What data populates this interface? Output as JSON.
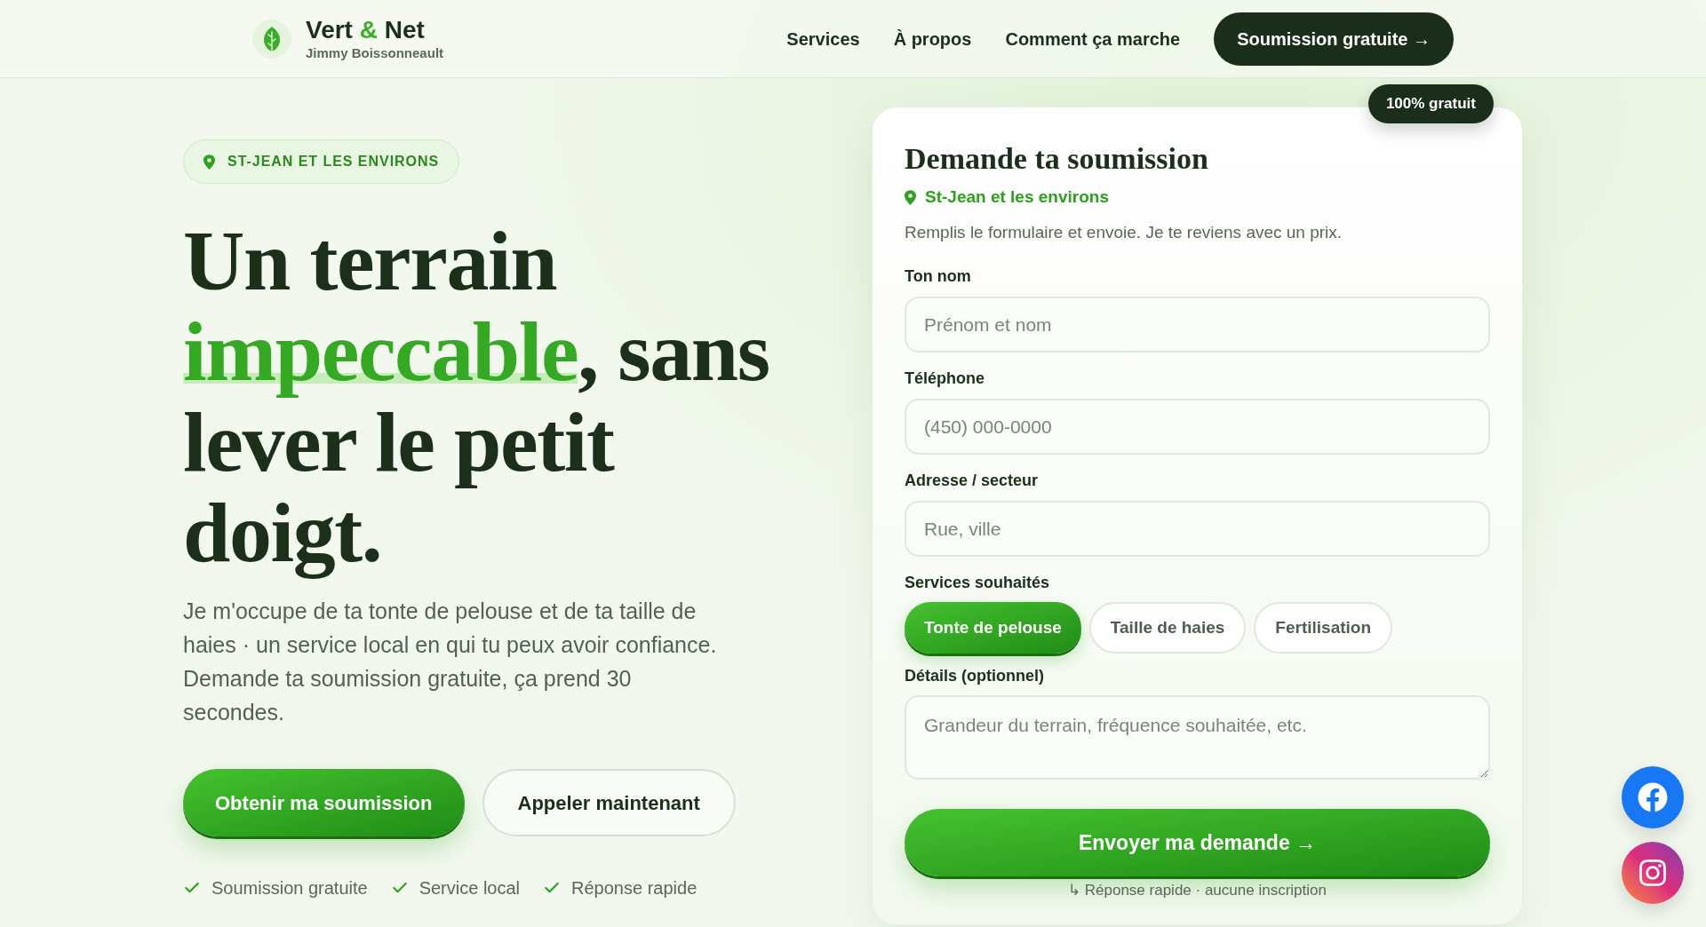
{
  "header": {
    "brand": {
      "name": [
        {
          "text": "Vert",
          "accent": false
        },
        {
          "text": "&",
          "accent": true
        },
        {
          "text": "Net",
          "accent": false
        }
      ],
      "owner": "Jimmy Boissonneault"
    },
    "nav": [
      "Services",
      "À propos",
      "Comment ça marche"
    ],
    "cta": "Soumission gratuite →"
  },
  "hero": {
    "location": "ST-JEAN ET LES ENVIRONS",
    "headline": [
      {
        "text": "Un terrain ",
        "accent": false
      },
      {
        "text": "impeccable",
        "accent": true
      },
      {
        "text": ", sans lever le petit doigt.",
        "accent": false
      }
    ],
    "description": "Je m'occupe de ta tonte de pelouse et de ta taille de haies · un service local en qui tu peux avoir confiance. Demande ta soumission gratuite, ça prend 30 secondes.",
    "buttons": [
      {
        "label": "Obtenir ma soumission",
        "kind": "primary"
      },
      {
        "label": "Appeler maintenant",
        "kind": "secondary"
      }
    ],
    "perks": [
      "Soumission gratuite",
      "Service local",
      "Réponse rapide"
    ]
  },
  "form": {
    "badge": "100% gratuit",
    "title": "Demande ta soumission",
    "location": "St-Jean et les environs",
    "intro": "Remplis le formulaire et envoie. Je te reviens avec un prix.",
    "fields": [
      {
        "label": "Ton nom",
        "placeholder": "Prénom et nom"
      },
      {
        "label": "Téléphone",
        "placeholder": "(450) 000-0000"
      },
      {
        "label": "Adresse / secteur",
        "placeholder": "Rue, ville"
      }
    ],
    "services": {
      "label": "Services souhaités",
      "options": [
        {
          "label": "Tonte de pelouse",
          "selected": true
        },
        {
          "label": "Taille de haies",
          "selected": false
        },
        {
          "label": "Fertilisation",
          "selected": false
        }
      ]
    },
    "details": {
      "label": "Détails (optionnel)",
      "placeholder": "Grandeur du terrain, fréquence souhaitée, etc."
    },
    "submit": "Envoyer ma demande →",
    "note": "↳ Réponse rapide · aucune inscription"
  }
}
